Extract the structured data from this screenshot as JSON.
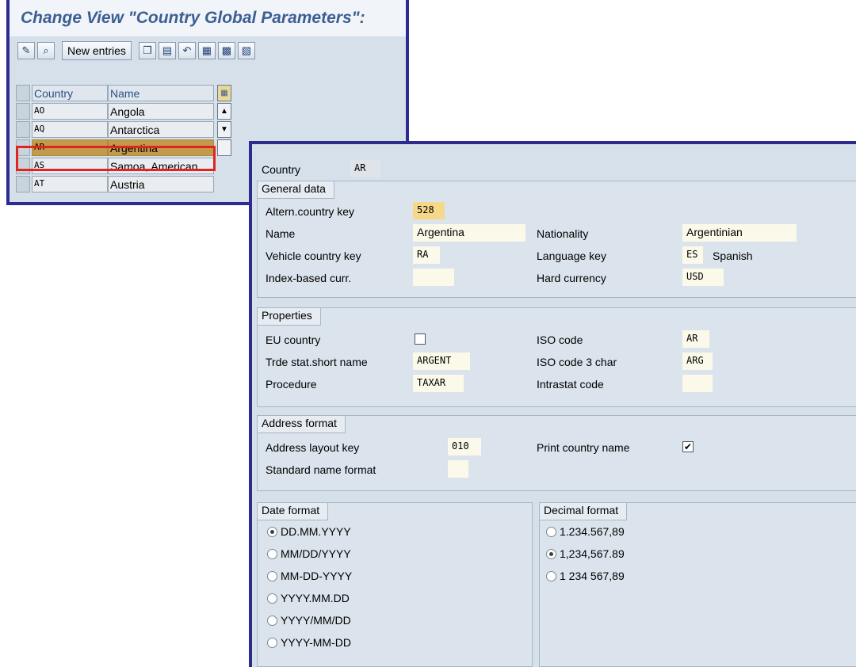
{
  "back_window": {
    "title": "Change View \"Country Global Parameters\":",
    "toolbar": {
      "new_entries_label": "New entries",
      "icons": [
        "edit-glasses-icon",
        "details-icon",
        "copy-icon",
        "delete-icon",
        "undo-icon",
        "select-all-icon",
        "select-block-icon",
        "deselect-all-icon"
      ]
    },
    "table": {
      "columns": [
        "Country",
        "Name"
      ],
      "rows": [
        {
          "country": "AO",
          "name": "Angola"
        },
        {
          "country": "AQ",
          "name": "Antarctica"
        },
        {
          "country": "AR",
          "name": "Argentina",
          "selected": true
        },
        {
          "country": "AS",
          "name": "Samoa, American"
        },
        {
          "country": "AT",
          "name": "Austria"
        }
      ]
    }
  },
  "detail": {
    "country_label": "Country",
    "country_value": "AR",
    "general": {
      "title": "General data",
      "altern_key_label": "Altern.country key",
      "altern_key_value": "528",
      "name_label": "Name",
      "name_value": "Argentina",
      "nationality_label": "Nationality",
      "nationality_value": "Argentinian",
      "vehicle_label": "Vehicle country key",
      "vehicle_value": "RA",
      "language_label": "Language key",
      "language_value": "ES",
      "language_text": "Spanish",
      "index_label": "Index-based curr.",
      "index_value": "",
      "hard_label": "Hard currency",
      "hard_value": "USD"
    },
    "properties": {
      "title": "Properties",
      "eu_label": "EU country",
      "eu_checked": false,
      "iso_label": "ISO code",
      "iso_value": "AR",
      "trde_label": "Trde stat.short name",
      "trde_value": "ARGENT",
      "iso3_label": "ISO code 3 char",
      "iso3_value": "ARG",
      "procedure_label": "Procedure",
      "procedure_value": "TAXAR",
      "intrastat_label": "Intrastat code",
      "intrastat_value": ""
    },
    "address": {
      "title": "Address format",
      "layout_label": "Address layout key",
      "layout_value": "010",
      "print_label": "Print country name",
      "print_checked": true,
      "stdname_label": "Standard name format",
      "stdname_value": ""
    },
    "date_format": {
      "title": "Date format",
      "options": [
        "DD.MM.YYYY",
        "MM/DD/YYYY",
        "MM-DD-YYYY",
        "YYYY.MM.DD",
        "YYYY/MM/DD",
        "YYYY-MM-DD"
      ],
      "selected": "DD.MM.YYYY"
    },
    "decimal_format": {
      "title": "Decimal format",
      "options": [
        "1.234.567,89",
        "1,234,567.89",
        "1 234 567,89"
      ],
      "selected": "1,234,567.89"
    }
  },
  "colors": {
    "window_border": "#2d2b8f",
    "panel_bg": "#d5e0ea",
    "title_text": "#3c5f93",
    "selection": "#c19a4b",
    "highlight_box": "#e32222",
    "input_bg": "#fbf9ea"
  }
}
